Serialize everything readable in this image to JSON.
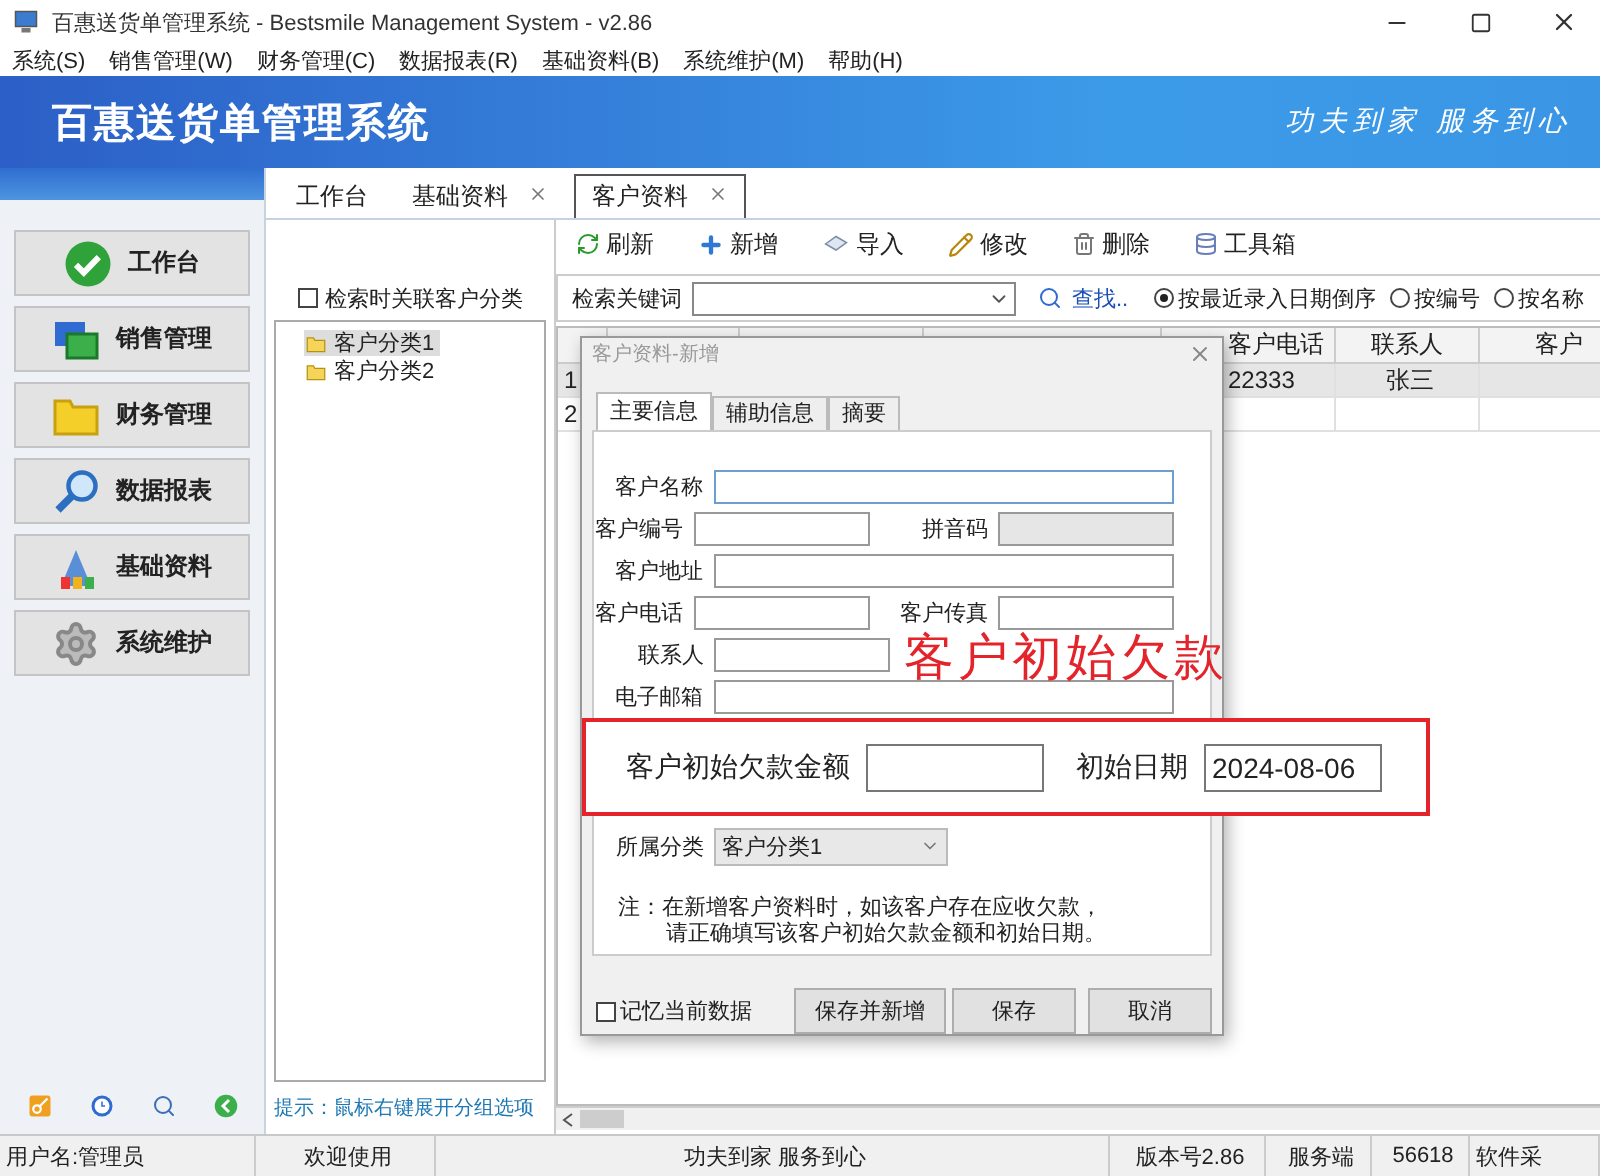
{
  "window": {
    "title": "百惠送货单管理系统 - Bestsmile Management System - v2.86"
  },
  "menu": [
    "系统(S)",
    "销售管理(W)",
    "财务管理(C)",
    "数据报表(R)",
    "基础资料(B)",
    "系统维护(M)",
    "帮助(H)"
  ],
  "banner": {
    "title": "百惠送货单管理系统",
    "slogan": "功夫到家 服务到心"
  },
  "sidebar": {
    "buttons": [
      "工作台",
      "销售管理",
      "财务管理",
      "数据报表",
      "基础资料",
      "系统维护"
    ]
  },
  "tabs": [
    {
      "label": "工作台",
      "selected": false,
      "closable": false
    },
    {
      "label": "基础资料",
      "selected": false,
      "closable": true
    },
    {
      "label": "客户资料",
      "selected": true,
      "closable": true
    }
  ],
  "toolbar": [
    "刷新",
    "新增",
    "导入",
    "修改",
    "删除",
    "工具箱"
  ],
  "tree_panel": {
    "filter": {
      "label": "检索时关联客户分类",
      "checked": false
    },
    "items": [
      {
        "label": "客户分类1",
        "selected": true
      },
      {
        "label": "客户分类2",
        "selected": false
      }
    ],
    "hint": "提示：鼠标右键展开分组选项"
  },
  "search": {
    "label": "检索关键词",
    "find": "查找..",
    "sort_options": [
      {
        "label": "按最近录入日期倒序",
        "selected": true
      },
      {
        "label": "按编号",
        "selected": false
      },
      {
        "label": "按名称",
        "selected": false
      }
    ]
  },
  "table": {
    "columns": [
      "客户电话",
      "联系人",
      "客户"
    ],
    "rows": [
      {
        "number": "1",
        "selected": true,
        "cells": [
          "22333",
          "张三"
        ]
      },
      {
        "number": "2",
        "selected": false
      }
    ]
  },
  "dialog": {
    "title": "客户资料-新增",
    "tabs": [
      {
        "label": "主要信息",
        "selected": true
      },
      {
        "label": "辅助信息",
        "selected": false
      },
      {
        "label": "摘要",
        "selected": false
      }
    ],
    "fields": [
      [
        {
          "label": "客户名称",
          "disabled": false,
          "focused": true
        }
      ],
      [
        {
          "label": "客户编号",
          "disabled": false,
          "focused": false
        },
        {
          "label": "拼音码",
          "disabled": true,
          "focused": false
        }
      ],
      [
        {
          "label": "客户地址",
          "disabled": false,
          "focused": false
        }
      ],
      [
        {
          "label": "客户电话",
          "disabled": false,
          "focused": false
        },
        {
          "label": "客户传真",
          "disabled": false,
          "focused": false
        }
      ],
      [
        {
          "label": "联系人",
          "disabled": false,
          "focused": false,
          "half": true
        }
      ],
      [
        {
          "label": "电子邮箱",
          "disabled": false,
          "focused": false
        }
      ]
    ],
    "opening_debt": {
      "amount_label": "客户初始欠款金额",
      "date_label": "初始日期",
      "date": "2024-08-06"
    },
    "category": {
      "label": "所属分类",
      "value": "客户分类1"
    },
    "note": [
      "注：在新增客户资料时，如该客户存在应收欠款，",
      "请正确填写该客户初始欠款金额和初始日期。"
    ],
    "remember": {
      "label": "记忆当前数据",
      "checked": false
    },
    "buttons": [
      "保存并新增",
      "保存",
      "取消"
    ]
  },
  "annotation": {
    "text": "客户初始欠款"
  },
  "status_bar": [
    "用户名:管理员",
    "欢迎使用",
    "功夫到家 服务到心",
    "版本号2.86",
    "服务端",
    "56618",
    "软件采"
  ]
}
